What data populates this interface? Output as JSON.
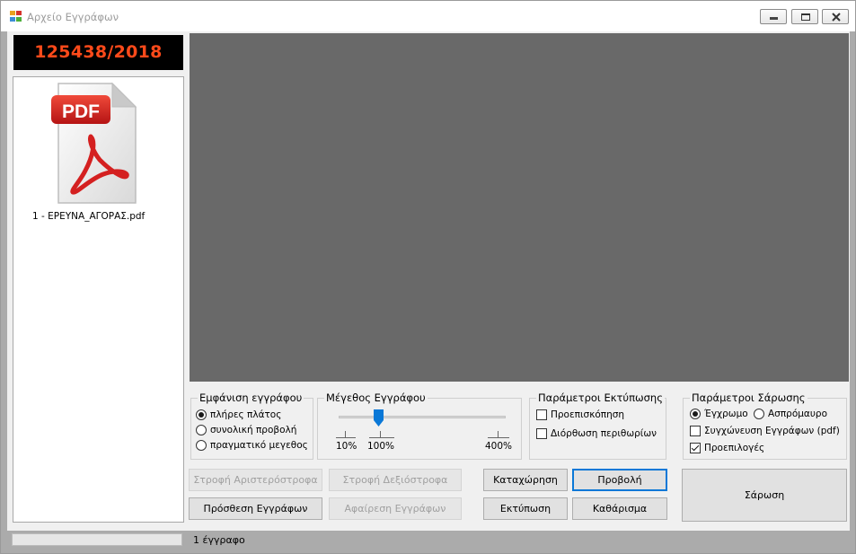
{
  "window": {
    "title": "Αρχείο Εγγράφων",
    "icon": "app-window-icon",
    "controls": [
      "minimize-icon",
      "maximize-icon",
      "close-icon"
    ]
  },
  "document_number": "125438/2018",
  "files": [
    {
      "icon": "pdf-file-icon",
      "icon_label": "PDF",
      "name": "1 - ΕΡΕΥΝΑ_ΑΓΟΡΑΣ.pdf"
    }
  ],
  "display_group": {
    "title": "Εμφάνιση εγγράφου",
    "options": [
      {
        "label": "πλήρες πλάτος",
        "selected": true
      },
      {
        "label": "συνολική προβολή",
        "selected": false
      },
      {
        "label": "πραγματικό μεγεθος",
        "selected": false
      }
    ]
  },
  "size_group": {
    "title": "Μέγεθος Εγγράφου",
    "ticks": [
      "10%",
      "100%",
      "400%"
    ],
    "slider_value_percent": 100
  },
  "print_group": {
    "title": "Παράμετροι Εκτύπωσης",
    "options": [
      {
        "label": "Προεπισκόπηση",
        "checked": false
      },
      {
        "label": "Διόρθωση περιθωρίων",
        "checked": false
      }
    ]
  },
  "scan_group": {
    "title": "Παράμετροι Σάρωσης",
    "color_options": [
      {
        "label": "Έγχρωμο",
        "selected": true
      },
      {
        "label": "Ασπρόμαυρο",
        "selected": false
      }
    ],
    "check_options": [
      {
        "label": "Συγχώνευση Εγγράφων (pdf)",
        "checked": false
      },
      {
        "label": "Προεπιλογές",
        "checked": true
      }
    ]
  },
  "buttons": {
    "rotate_left": "Στροφή Αριστερόστροφα",
    "rotate_right": "Στροφή Δεξιόστροφα",
    "add_documents": "Πρόσθεση Εγγράφων",
    "remove_documents": "Αφαίρεση Εγγράφων",
    "register": "Καταχώρηση",
    "view": "Προβολή",
    "print": "Εκτύπωση",
    "clear": "Καθάρισμα",
    "scan": "Σάρωση"
  },
  "status": {
    "text": "1 έγγραφο"
  },
  "colors": {
    "doc_number_text": "#ff4a1a",
    "viewer_background": "#696969",
    "focus_border": "#0a78d7",
    "pdf_red": "#d42020"
  }
}
